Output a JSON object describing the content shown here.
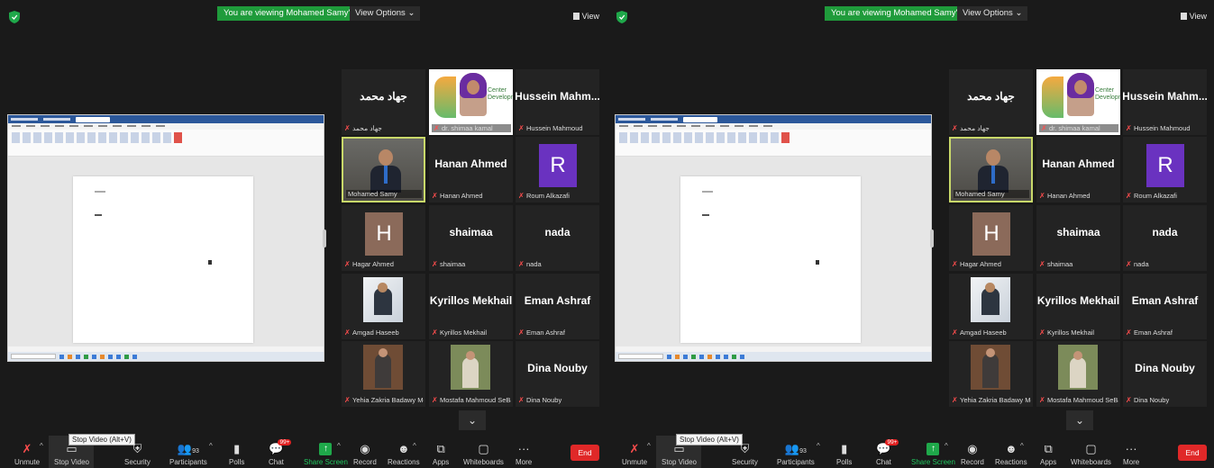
{
  "banner": "You are viewing Mohamed Samy's screen",
  "view_options": "View Options ⌄",
  "view_label": "View",
  "tiles": [
    {
      "big": "جهاد محمد",
      "caption": "جهاد محمد"
    },
    {
      "big": "",
      "caption": "dr. shimaa kamal",
      "logo_text": "Center Development"
    },
    {
      "big": "Hussein  Mahm...",
      "caption": "Hussein Mahmoud"
    },
    {
      "big": "",
      "caption": "Mohamed Samy"
    },
    {
      "big": "Hanan Ahmed",
      "caption": "Hanan Ahmed"
    },
    {
      "big": "",
      "avatar": "R",
      "caption": "Roum Alkazafi"
    },
    {
      "big": "",
      "avatar": "H",
      "caption": "Hagar Ahmed"
    },
    {
      "big": "shaimaa",
      "caption": "shaimaa"
    },
    {
      "big": "nada",
      "caption": "nada"
    },
    {
      "big": "",
      "caption": "Amgad Haseeb"
    },
    {
      "big": "Kyrillos Mekhail",
      "caption": "Kyrillos Mekhail"
    },
    {
      "big": "Eman Ashraf",
      "caption": "Eman Ashraf"
    },
    {
      "big": "",
      "caption": "Yehia Zakria Badawy Mo..."
    },
    {
      "big": "",
      "caption": "Mostafa Mahmoud SeBa"
    },
    {
      "big": "Dina Nouby",
      "caption": "Dina Nouby"
    }
  ],
  "toolbar": {
    "unmute": "Unmute",
    "stop_video": "Stop Video",
    "tooltip": "Stop Video (Alt+V)",
    "security": "Security",
    "participants": "Participants",
    "participants_count": "93",
    "polls": "Polls",
    "chat": "Chat",
    "chat_badge": "99+",
    "share_screen": "Share Screen",
    "record": "Record",
    "reactions": "Reactions",
    "apps": "Apps",
    "whiteboards": "Whiteboards",
    "more": "More",
    "end": "End"
  },
  "colors": {
    "banner": "#1f9b3b",
    "active_border": "#c9d96a",
    "end": "#e02828",
    "roum": "#6a32c0",
    "hagar": "#8b6a5a"
  }
}
